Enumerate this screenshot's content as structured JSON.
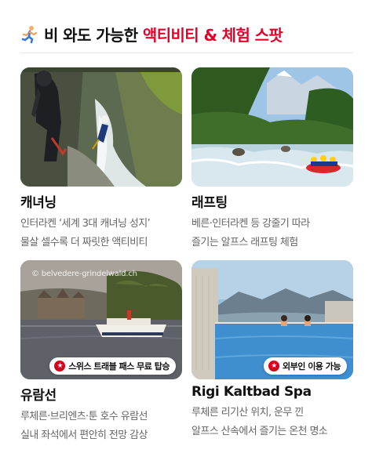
{
  "header": {
    "icon": "runner-icon",
    "title_plain": "비 와도 가능한 ",
    "title_accent": "액티비티 & 체험 스팟",
    "accent_color": "#e4002b"
  },
  "cards": [
    {
      "title": "캐녀닝",
      "desc_line1": "인터라켄 ‘세계 3대 캐녀닝 성지’",
      "desc_line2": "물살 셀수록 더 짜릿한 액티비티"
    },
    {
      "title": "래프팅",
      "desc_line1": "베른·인터라켄 등 강줄기 따라",
      "desc_line2": "즐기는 알프스 래프팅 체험"
    },
    {
      "title": "유람선",
      "desc_line1": "루체른·브리엔츠·툰 호수 유람선",
      "desc_line2": "실내 좌석에서 편안히 전망 감상",
      "badge": "스위스 트래블 패스 무료 탑승",
      "watermark": "© belvedere-grindelwald.ch"
    },
    {
      "title": "Rigi Kaltbad Spa",
      "desc_line1": "루체른 리기산 위치, 운무 낀",
      "desc_line2": "알프스 산속에서 즐기는 온천 명소",
      "badge": "외부인 이용 가능"
    }
  ],
  "badge_icon": "star-icon",
  "badge_color": "#d6001c"
}
